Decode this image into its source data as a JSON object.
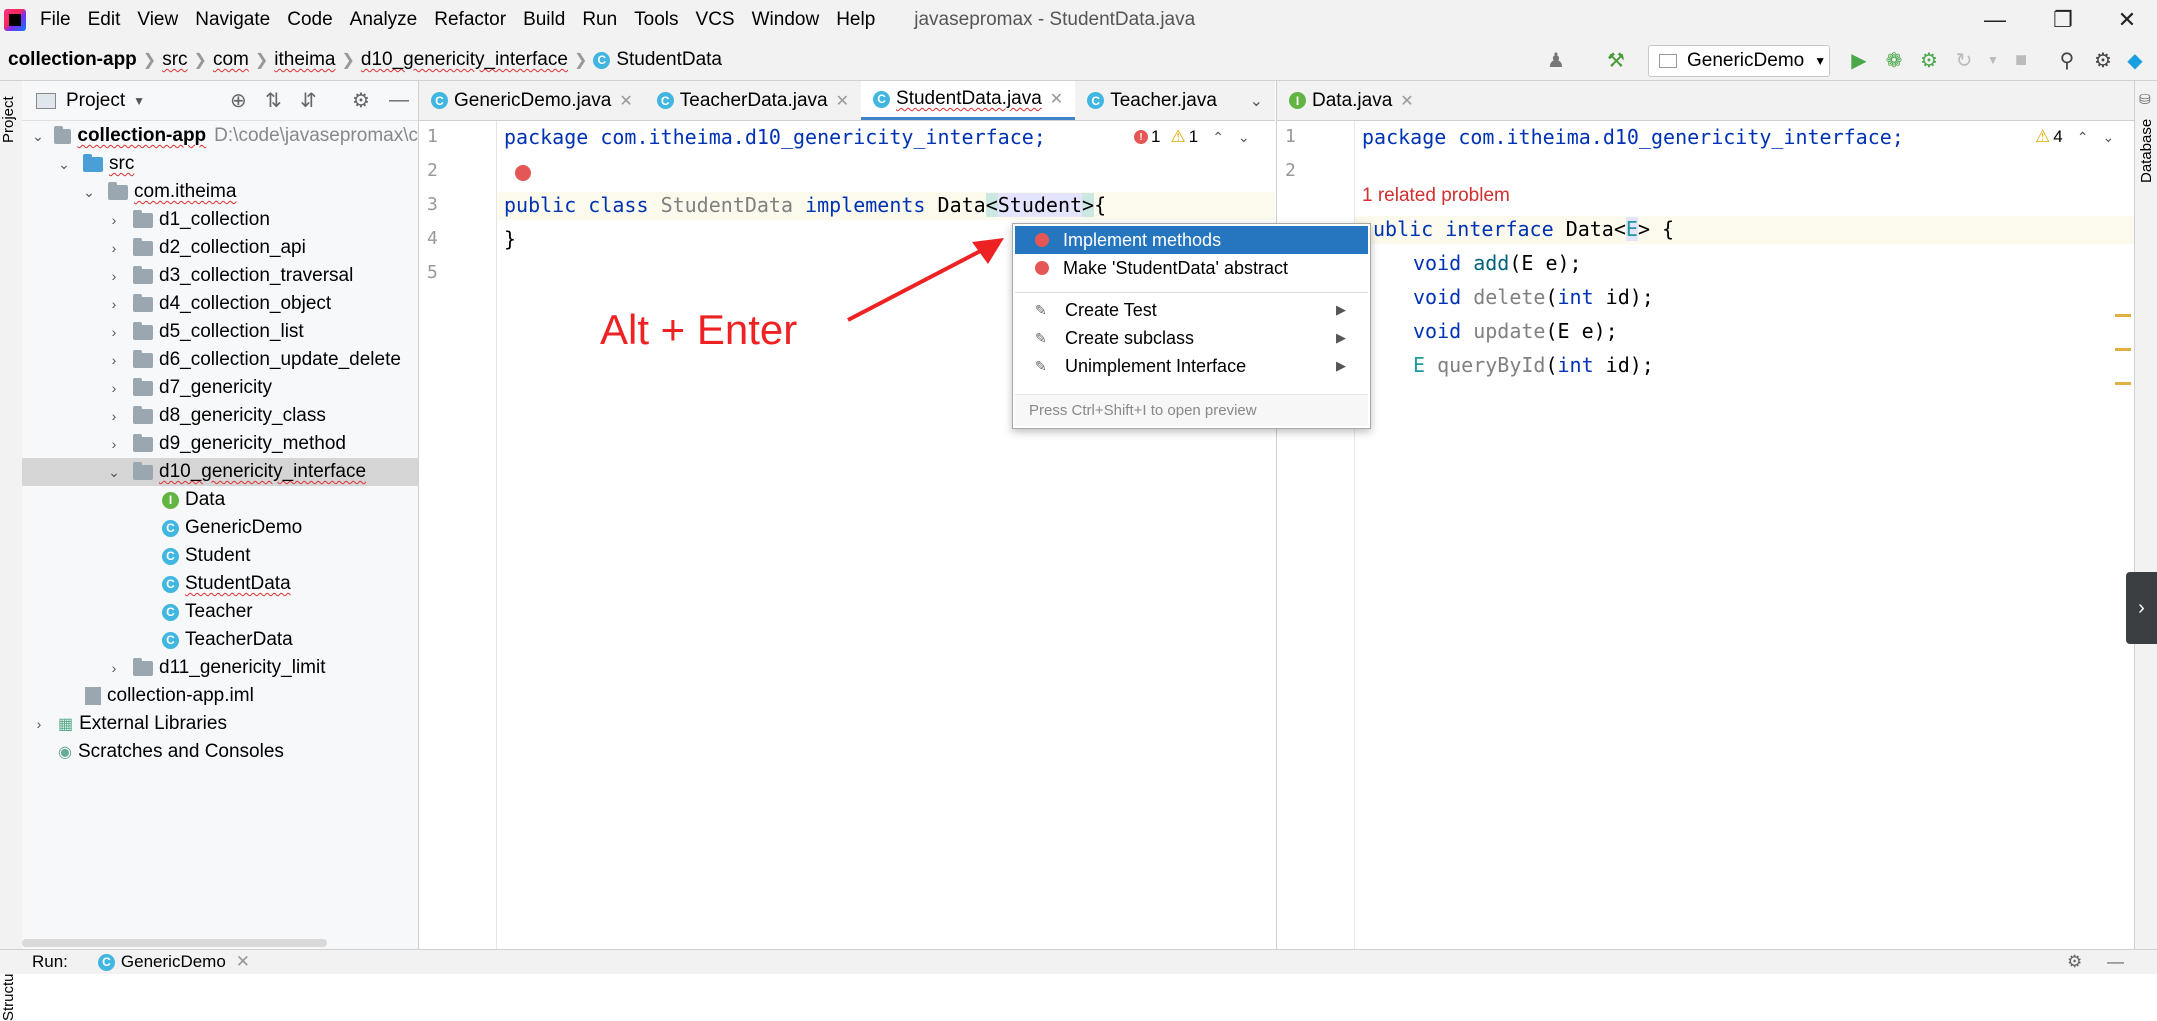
{
  "window_title": "javasepromax - StudentData.java",
  "menu": [
    "File",
    "Edit",
    "View",
    "Navigate",
    "Code",
    "Analyze",
    "Refactor",
    "Build",
    "Run",
    "Tools",
    "VCS",
    "Window",
    "Help"
  ],
  "breadcrumb": [
    "collection-app",
    "src",
    "com",
    "itheima",
    "d10_genericity_interface",
    "StudentData"
  ],
  "run_config": "GenericDemo",
  "project_panel": {
    "title": "Project",
    "root_name": "collection-app",
    "root_path": "D:\\code\\javasepromax\\c",
    "src": "src",
    "package": "com.itheima",
    "folders": [
      "d1_collection",
      "d2_collection_api",
      "d3_collection_traversal",
      "d4_collection_object",
      "d5_collection_list",
      "d6_collection_update_delete",
      "d7_genericity",
      "d8_genericity_class",
      "d9_genericity_method",
      "d10_genericity_interface"
    ],
    "files": [
      "Data",
      "GenericDemo",
      "Student",
      "StudentData",
      "Teacher",
      "TeacherData"
    ],
    "folder_after": "d11_genericity_limit",
    "iml": "collection-app.iml",
    "external": "External Libraries",
    "scratches": "Scratches and Consoles"
  },
  "left_tabs": [
    "GenericDemo.java",
    "TeacherData.java",
    "StudentData.java",
    "Teacher.java"
  ],
  "right_tabs": [
    "Data.java"
  ],
  "left_editor": {
    "lines": [
      "1",
      "2",
      "3",
      "4",
      "5"
    ],
    "line1": "package com.itheima.d10_genericity_interface;",
    "line3_kw1": "public",
    "line3_kw2": "class",
    "line3_cls": "StudentData",
    "line3_kw3": "implements",
    "line3_iface": "Data",
    "line3_lt": "<",
    "line3_type": "Student",
    "line3_gt": ">",
    "line3_brace": "{",
    "line4": "}",
    "errors": "1",
    "warnings": "1"
  },
  "right_editor": {
    "lines": [
      "1",
      "2"
    ],
    "line1": "package com.itheima.d10_genericity_interface;",
    "related_problem": "1 related problem",
    "decl_kw1": "ublic",
    "decl_kw2": "interface",
    "decl_name": "Data",
    "decl_lt": "<",
    "decl_type": "E",
    "decl_rest": "> {",
    "m1_kw": "void",
    "m1_name": "add",
    "m1_rest": "(E e);",
    "m2_kw": "void",
    "m2_name": "delete",
    "m2_open": "(",
    "m2_int": "int",
    "m2_rest": " id);",
    "m3_kw": "void",
    "m3_name": "update",
    "m3_rest": "(E e);",
    "m4_type": "E",
    "m4_name": "queryById",
    "m4_open": "(",
    "m4_int": "int",
    "m4_rest": " id);",
    "warnings": "4"
  },
  "popup": {
    "items": [
      "Implement methods",
      "Make 'StudentData' abstract",
      "Create Test",
      "Create subclass",
      "Unimplement Interface"
    ],
    "hint": "Press Ctrl+Shift+I to open preview"
  },
  "annotation": "Alt + Enter",
  "side_labels": {
    "project": "Project",
    "structure": "Structure",
    "database": "Database"
  },
  "bottom": {
    "run": "Run:",
    "config": "GenericDemo"
  },
  "colors": {
    "annotation": "#ee2222",
    "selection": "#2675bf",
    "keyword": "#0033b3"
  }
}
